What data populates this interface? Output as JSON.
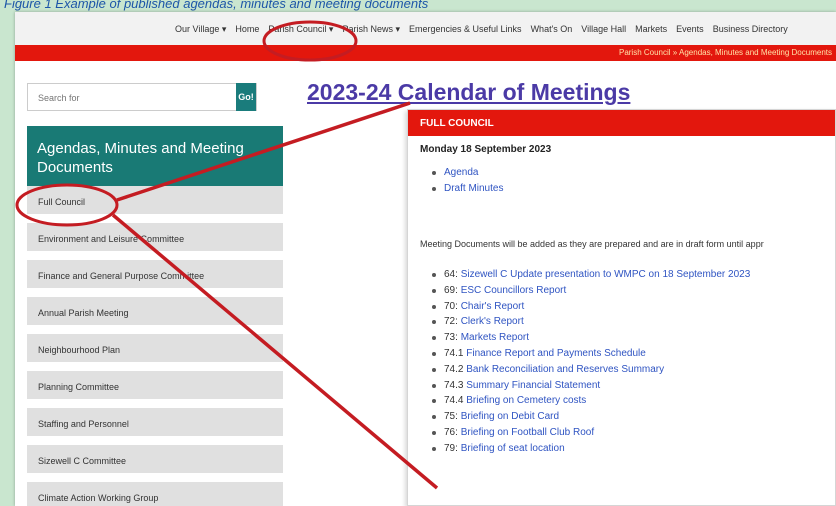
{
  "caption": "Figure 1 Example of published agendas, minutes and meeting documents",
  "nav": {
    "items": [
      "Our Village ▾",
      "Home",
      "Parish Council ▾",
      "Parish News ▾",
      "Emergencies & Useful Links",
      "What's On",
      "Village Hall",
      "Markets",
      "Events",
      "Business Directory"
    ]
  },
  "breadcrumb": "Parish Council » Agendas, Minutes and Meeting Documents",
  "search": {
    "placeholder": "Search for",
    "go_label": "Go!"
  },
  "page_title": "2023-24 Calendar of Meetings",
  "sidebar": {
    "heading": "Agendas, Minutes and Meeting Documents",
    "items": [
      "Full Council",
      "Environment and Leisure Committee",
      "Finance and General Purpose Committee",
      "Annual Parish Meeting",
      "Neighbourhood Plan",
      "Planning Committee",
      "Staffing and Personnel",
      "Sizewell C Committee",
      "Climate Action Working Group"
    ]
  },
  "panel": {
    "heading": "FULL COUNCIL",
    "date": "Monday 18 September 2023",
    "links": [
      "Agenda",
      "Draft Minutes"
    ],
    "note": "Meeting Documents will be added as they are prepared and are in draft form until appr",
    "documents": [
      {
        "num": "64:",
        "title": "Sizewell C Update presentation to WMPC on 18 September 2023"
      },
      {
        "num": "69:",
        "title": "ESC Councillors Report"
      },
      {
        "num": "70:",
        "title": "Chair's Report"
      },
      {
        "num": "72:",
        "title": "Clerk's Report"
      },
      {
        "num": "73:",
        "title": "Markets Report"
      },
      {
        "num": "74.1",
        "title": "Finance Report and Payments Schedule"
      },
      {
        "num": "74.2",
        "title": "Bank Reconciliation and Reserves Summary"
      },
      {
        "num": "74.3",
        "title": "Summary Financial Statement"
      },
      {
        "num": "74.4",
        "title": "Briefing on Cemetery costs"
      },
      {
        "num": "75:",
        "title": "Briefing on Debit Card"
      },
      {
        "num": "76:",
        "title": "Briefing on Football Club Roof"
      },
      {
        "num": "79:",
        "title": "Briefing of seat location"
      }
    ]
  },
  "colors": {
    "accent_red": "#e3170d",
    "teal": "#197a75",
    "link": "#2f54c2",
    "title": "#4b3aa6",
    "annotation": "#c41c22",
    "background": "#c9e6cf"
  }
}
